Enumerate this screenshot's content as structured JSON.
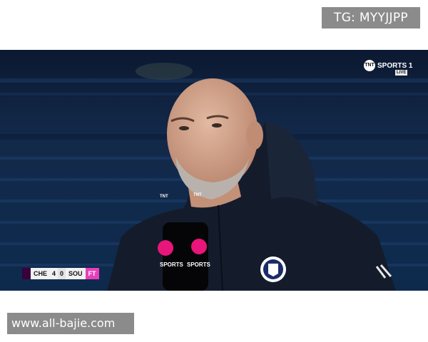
{
  "watermarks": {
    "top_right": "TG: MYYJJPP",
    "bottom_left": "www.all-bajie.com"
  },
  "broadcast": {
    "channel": "SPORTS 1",
    "channel_logo_text": "TNT",
    "live_label": "LIVE",
    "mic_logo_text": "TNT",
    "mic_brand_text": "SPORTS"
  },
  "scoreboard": {
    "home_team": "CHE",
    "home_score": "4",
    "away_score": "0",
    "away_team": "SOU",
    "status": "FT"
  },
  "colors": {
    "stadium_blue": "#0d2a4d",
    "jacket": "#141c2c",
    "tnt_pink": "#e8157a",
    "status_magenta": "#e83fba"
  }
}
